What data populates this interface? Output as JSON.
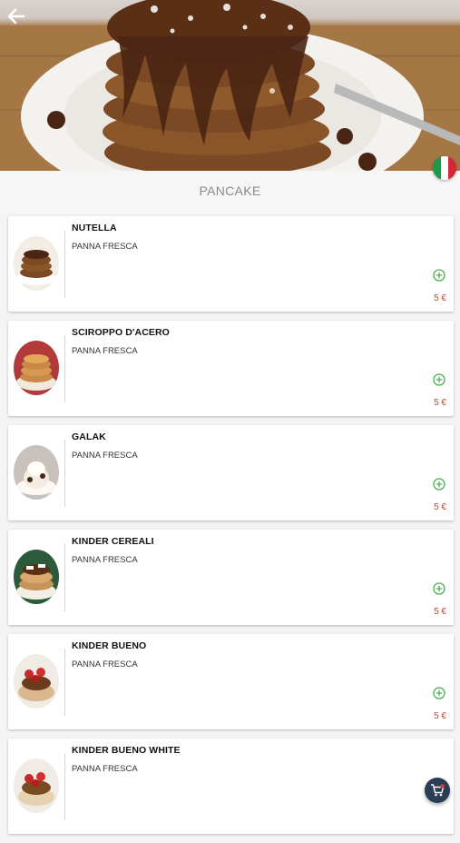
{
  "header": {
    "back_icon": "arrow-left-icon",
    "language_flag": "italy-flag",
    "category_title": "PANCAKE"
  },
  "colors": {
    "price": "#c9472e",
    "add_icon": "#4caf50",
    "cart_button": "#2b3d55"
  },
  "products": [
    {
      "name": "NUTELLA",
      "description": "PANNA FRESCA",
      "price": "5 €"
    },
    {
      "name": "SCIROPPO D'ACERO",
      "description": "PANNA FRESCA",
      "price": "5 €"
    },
    {
      "name": "GALAK",
      "description": "PANNA FRESCA",
      "price": "5 €"
    },
    {
      "name": "KINDER CEREALI",
      "description": "PANNA FRESCA",
      "price": "5 €"
    },
    {
      "name": "KINDER BUENO",
      "description": "PANNA FRESCA",
      "price": "5 €"
    },
    {
      "name": "KINDER BUENO WHITE",
      "description": "PANNA FRESCA",
      "price": ""
    }
  ],
  "cart": {
    "icon": "cart-icon"
  }
}
